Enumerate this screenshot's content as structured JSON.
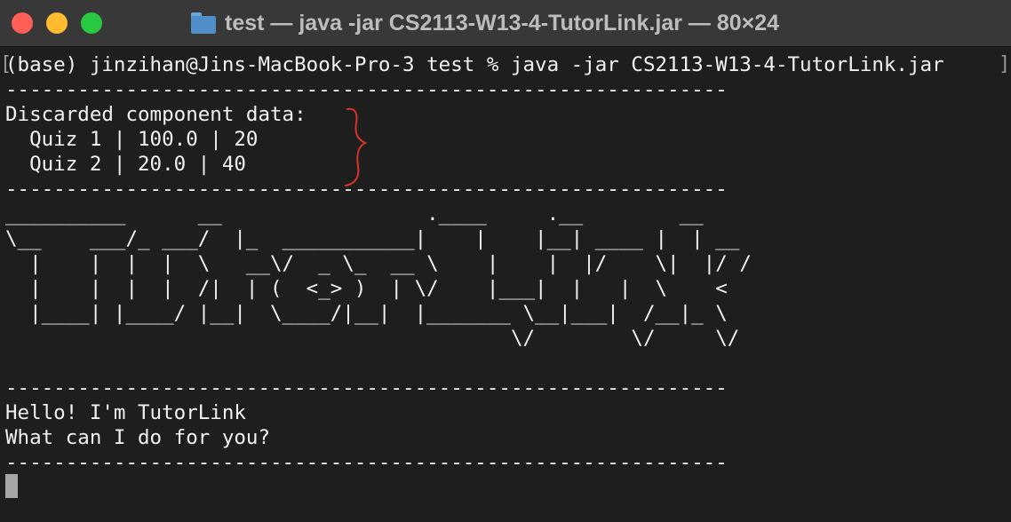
{
  "window": {
    "title": "test — java -jar CS2113-W13-4-TutorLink.jar — 80×24",
    "controls": {
      "close_color": "#fe5f57",
      "minimize_color": "#febc2e",
      "zoom_color": "#28c840"
    },
    "title_icon": "folder-icon"
  },
  "terminal": {
    "bracket_left": "[",
    "bracket_right": "]",
    "lines": [
      "(base) jinzihan@Jins-MacBook-Pro-3 test % java -jar CS2113-W13-4-TutorLink.jar",
      "------------------------------------------------------------",
      "Discarded component data:",
      "  Quiz 1 | 100.0 | 20",
      "  Quiz 2 | 20.0 | 40",
      "------------------------------------------------------------",
      "__________      __                 .____     .__        __",
      "\\__    ___/_ ___/  |_  ___________|    |    |__| ____ |  | __",
      "  |    |  |  |  \\   __\\/  _ \\_  __ \\    |    |  |/    \\|  |/ /",
      "  |    |  |  |  /|  | (  <_> )  | \\/    |___|  |   |  \\    <",
      "  |____| |____/ |__|  \\____/|__|  |_______ \\__|___|  /__|_ \\",
      "                                          \\/        \\/     \\/",
      "",
      "------------------------------------------------------------",
      "Hello! I'm TutorLink",
      "What can I do for you?",
      "------------------------------------------------------------"
    ],
    "annotation_color": "#d9342b",
    "cursor_color": "#a6a6a6"
  }
}
